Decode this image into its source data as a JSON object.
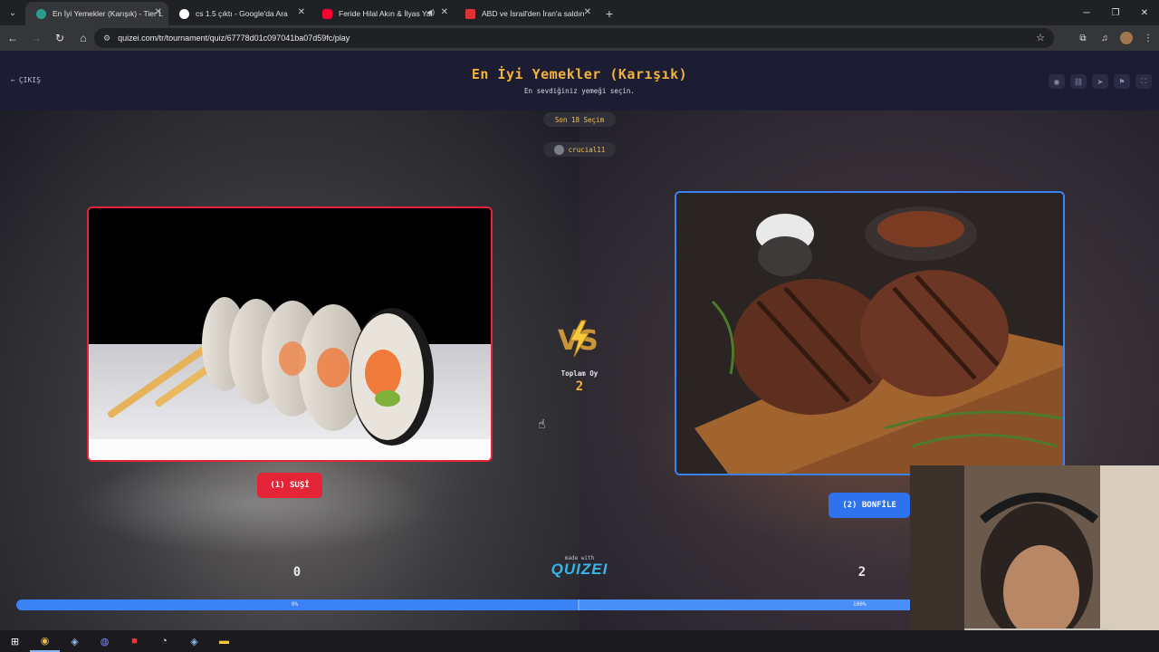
{
  "browser": {
    "tabs": [
      {
        "title": "En İyi Yemekler (Karışık) - Tier L",
        "active": true,
        "favicon_color": "#2a9d8f"
      },
      {
        "title": "cs 1.5 çıktı - Google'da Ara",
        "active": false,
        "favicon_color": "#ffffff"
      },
      {
        "title": "Feride Hilal Akın & İlyas Yal",
        "active": false,
        "favicon_color": "#ff0033"
      },
      {
        "title": "ABD ve İsrail'den İran'a saldırı",
        "active": false,
        "favicon_color": "#d33"
      }
    ],
    "url": "quizei.com/tr/tournament/quiz/67778d01c097041ba07d59fc/play"
  },
  "header": {
    "back_label": "ÇIKIŞ",
    "title": "En İyi Yemekler (Karışık)",
    "subtitle": "En sevdiğiniz yemeği seçin."
  },
  "arena": {
    "recent_label": "Son 18 Seçim",
    "username": "crucial11",
    "left": {
      "button_label": "(1) SUŞİ",
      "score": "0",
      "percent": "0%",
      "accent": "#e52438"
    },
    "right": {
      "button_label": "(2) BONFİLE",
      "score": "2",
      "percent": "100%",
      "accent": "#2f72ee"
    },
    "total_label": "Toplam Oy",
    "total_value": "2",
    "made_with": "made with",
    "brand": "QUIZEI",
    "right_share": 1.0
  },
  "icons": {
    "header": [
      "eye-icon",
      "link-icon",
      "send-icon",
      "flag-icon",
      "fullscreen-icon"
    ],
    "taskbar": [
      "windows-start-icon",
      "chrome-icon",
      "steam-icon",
      "discord-icon",
      "app-red-icon",
      "app-gauge-icon",
      "steam-icon-2",
      "file-explorer-icon"
    ]
  }
}
